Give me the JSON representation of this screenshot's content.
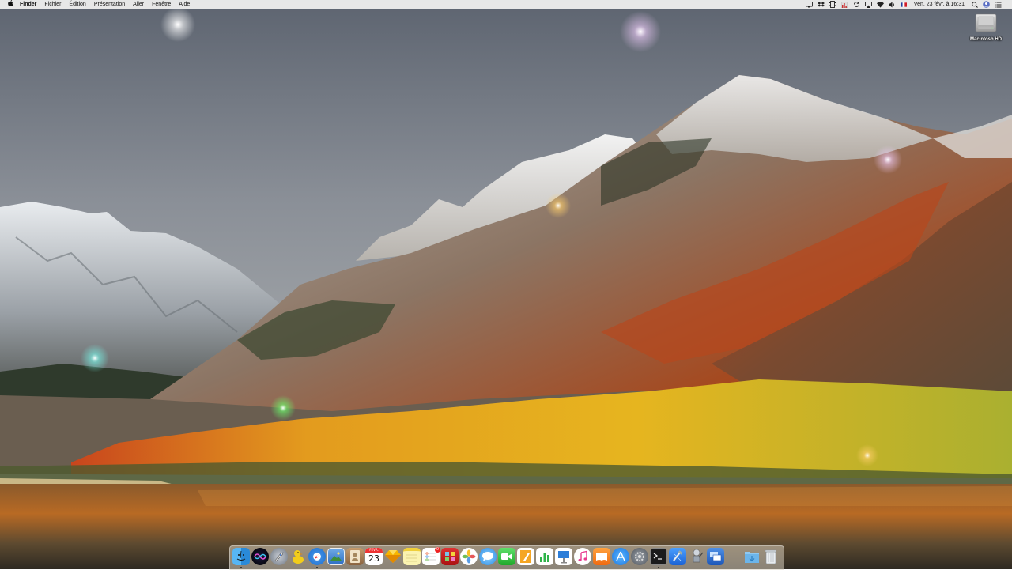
{
  "menubar": {
    "app_name": "Finder",
    "menus": [
      "Fichier",
      "Édition",
      "Présentation",
      "Aller",
      "Fenêtre",
      "Aide"
    ],
    "status_icons": [
      "display-icon",
      "dropbox-icon",
      "memory-icon",
      "activity-icon",
      "sync-icon",
      "airplay-icon",
      "wifi-icon",
      "volume-icon",
      "flag-icon"
    ],
    "clock": "Ven. 23 févr. à 16:31",
    "right_icons": [
      "search-icon",
      "user-icon",
      "notification-center-icon"
    ]
  },
  "desktop": {
    "disk_label": "Macintosh HD"
  },
  "dock": {
    "items": [
      {
        "name": "finder",
        "running": true
      },
      {
        "name": "siri",
        "running": false
      },
      {
        "name": "launchpad",
        "running": false
      },
      {
        "name": "cyberduck",
        "running": false
      },
      {
        "name": "safari",
        "running": true
      },
      {
        "name": "preview",
        "running": false
      },
      {
        "name": "contacts",
        "running": false
      },
      {
        "name": "calendar",
        "running": false,
        "month": "FÉVR.",
        "day": "23"
      },
      {
        "name": "sketch",
        "running": false
      },
      {
        "name": "notes",
        "running": false
      },
      {
        "name": "reminders",
        "running": false,
        "badge": "9"
      },
      {
        "name": "photo-booth",
        "running": false
      },
      {
        "name": "photos",
        "running": false
      },
      {
        "name": "messages",
        "running": false
      },
      {
        "name": "facetime",
        "running": false
      },
      {
        "name": "pages",
        "running": false
      },
      {
        "name": "numbers",
        "running": false
      },
      {
        "name": "keynote",
        "running": false
      },
      {
        "name": "itunes",
        "running": false
      },
      {
        "name": "ibooks",
        "running": false
      },
      {
        "name": "app-store",
        "running": false
      },
      {
        "name": "system-preferences",
        "running": false
      },
      {
        "name": "terminal",
        "running": true
      },
      {
        "name": "xcode",
        "running": false
      },
      {
        "name": "automator",
        "running": false
      },
      {
        "name": "screen-sharing",
        "running": false
      },
      {
        "name": "downloads-folder",
        "running": false
      },
      {
        "name": "trash",
        "running": false
      }
    ]
  }
}
